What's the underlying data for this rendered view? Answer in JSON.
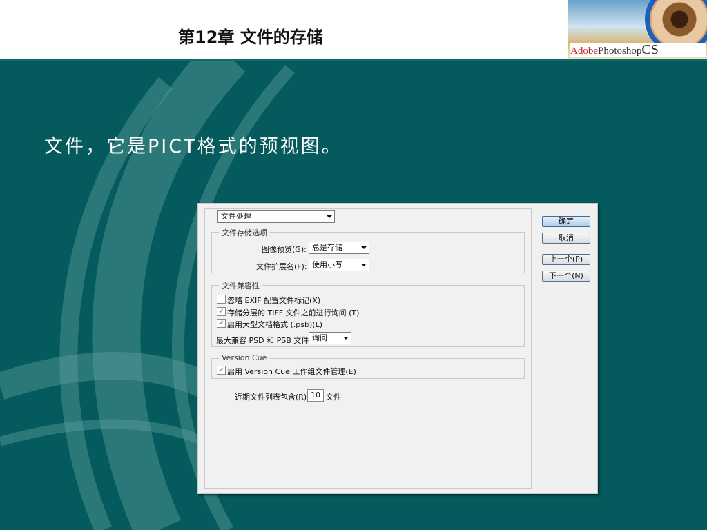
{
  "slide": {
    "title": "第12章 文件的存储",
    "subtitle": "文件，它是PICT格式的预视图。",
    "logo": {
      "adobe": "Adobe",
      "photoshop": "Photoshop",
      "cs": "CS"
    },
    "colors": {
      "background": "#045a5c",
      "header": "#ffffff"
    }
  },
  "dialog": {
    "panel_select": "文件处理",
    "file_saving": {
      "legend": "文件存储选项",
      "image_preview_label": "图像预览(G):",
      "image_preview_value": "总是存储",
      "extension_label": "文件扩展名(F):",
      "extension_value": "使用小写"
    },
    "compat": {
      "legend": "文件兼容性",
      "ignore_exif": "忽略 EXIF 配置文件标记(X)",
      "ignore_exif_checked": false,
      "ask_tiff": "存储分层的 TIFF 文件之前进行询问  (T)",
      "ask_tiff_checked": true,
      "large_doc": "启用大型文档格式 (.psb)(L)",
      "large_doc_checked": true,
      "max_compat_label": "最大兼容 PSD 和 PSB 文件:",
      "max_compat_value": "询问"
    },
    "version_cue": {
      "legend": "Version Cue",
      "enable": "启用 Version Cue 工作组文件管理(E)",
      "enable_checked": true
    },
    "recent_label": "近期文件列表包含(R):",
    "recent_value": "10",
    "recent_unit": "文件",
    "buttons": {
      "ok": "确定",
      "cancel": "取消",
      "prev": "上一个(P)",
      "next": "下一个(N)"
    }
  }
}
